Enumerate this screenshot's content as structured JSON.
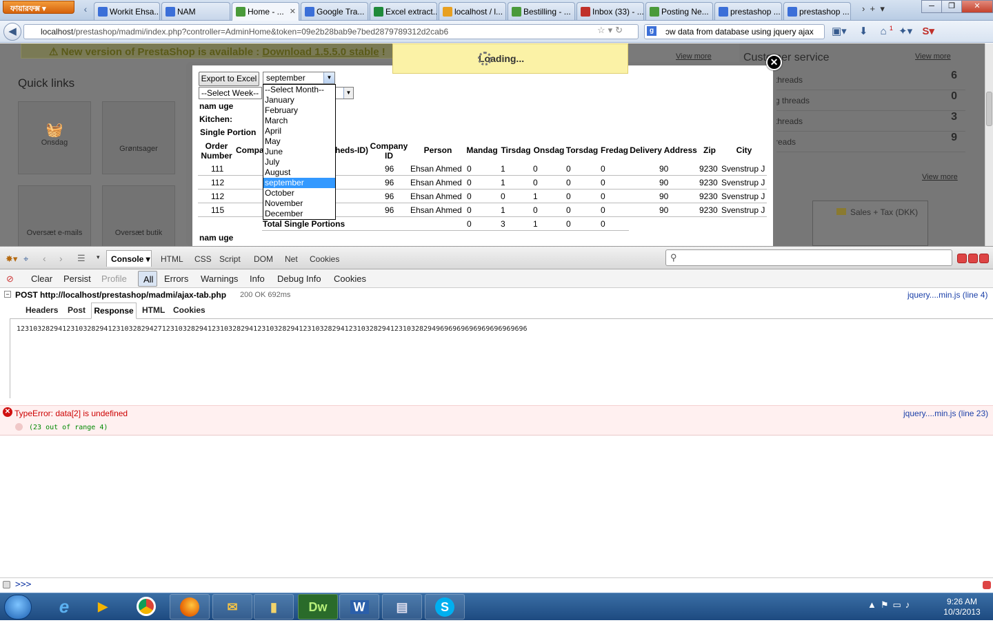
{
  "browser": {
    "firefox_button": "ফায়ারফক্স",
    "tabs": [
      {
        "label": "Workit Ehsa...",
        "color": "#3b6fd8"
      },
      {
        "label": "NAM",
        "color": "#3b6fd8"
      },
      {
        "label": "Home - ...",
        "color": "#4a9a3a"
      },
      {
        "label": "Google Tra...",
        "color": "#3b6fd8"
      },
      {
        "label": "Excel extract...",
        "color": "#1f8a3a"
      },
      {
        "label": "localhost / l...",
        "color": "#e8a020"
      },
      {
        "label": "Bestilling - ...",
        "color": "#4a9a3a"
      },
      {
        "label": "Inbox (33) - ...",
        "color": "#c0302a"
      },
      {
        "label": "Posting Ne...",
        "color": "#4a9a3a"
      },
      {
        "label": "prestashop ...",
        "color": "#3b6fd8"
      },
      {
        "label": "prestashop ...",
        "color": "#3b6fd8"
      }
    ],
    "url_host": "localhost",
    "url_path": "/prestashop/madmi/index.php?controller=AdminHome&token=09e2b28bab9e7bed2879789312d2cab6",
    "search_value": "ɔw data from database using jquery ajax",
    "search_engine_letter": "g",
    "badge_count": "1"
  },
  "page": {
    "notice_text": "New version of PrestaShop is available : ",
    "notice_link": "Download 1.5.5.0 stable",
    "notice_tail": " !",
    "view_more": "View more",
    "quick_links_title": "Quick links",
    "quick_links": [
      "Onsdag",
      "Grøntsager",
      "Oversæt e-mails",
      "Oversæt butik"
    ],
    "customer_service_title": "Customer service",
    "cs_rows": [
      {
        "label": "threads",
        "value": "6"
      },
      {
        "label": "g threads",
        "value": "0"
      },
      {
        "label": "threads",
        "value": "3"
      },
      {
        "label": "reads",
        "value": "9"
      }
    ],
    "chart_legend": "Sales + Tax (DKK)"
  },
  "modal": {
    "loading_text": "Loading...",
    "export_button": "Export to Excel",
    "month_selected": "september",
    "week_placeholder": "--Select Week--",
    "months": [
      "--Select Month--",
      "January",
      "February",
      "March",
      "April",
      "May",
      "June",
      "July",
      "August",
      "september",
      "October",
      "November",
      "December"
    ],
    "labels": {
      "nam_uge": "nam uge",
      "kitchen": "Kitchen:",
      "single_portion": "Single Portion",
      "nam_uge_2": "nam uge"
    },
    "headers": {
      "order_number": "Order Number",
      "company": "Compa",
      "heds_id": "heds-ID)",
      "company_id": "Company ID",
      "person": "Person",
      "mandag": "Mandag",
      "tirsdag": "Tirsdag",
      "onsdag": "Onsdag",
      "torsdag": "Torsdag",
      "fredag": "Fredag",
      "delivery": "Delivery Address",
      "zip": "Zip",
      "city": "City"
    },
    "rows": [
      {
        "order": "111",
        "company_id": "96",
        "person": "Ehsan Ahmed",
        "mandag": "0",
        "tirsdag": "1",
        "onsdag": "0",
        "torsdag": "0",
        "fredag": "0",
        "delivery": "90",
        "zip": "9230",
        "city": "Svenstrup J"
      },
      {
        "order": "112",
        "company_id": "96",
        "person": "Ehsan Ahmed",
        "mandag": "0",
        "tirsdag": "1",
        "onsdag": "0",
        "torsdag": "0",
        "fredag": "0",
        "delivery": "90",
        "zip": "9230",
        "city": "Svenstrup J"
      },
      {
        "order": "112",
        "company_id": "96",
        "person": "Ehsan Ahmed",
        "mandag": "0",
        "tirsdag": "0",
        "onsdag": "1",
        "torsdag": "0",
        "fredag": "0",
        "delivery": "90",
        "zip": "9230",
        "city": "Svenstrup J"
      },
      {
        "order": "115",
        "company_id": "96",
        "person": "Ehsan Ahmed",
        "mandag": "0",
        "tirsdag": "1",
        "onsdag": "0",
        "torsdag": "0",
        "fredag": "0",
        "delivery": "90",
        "zip": "9230",
        "city": "Svenstrup J"
      }
    ],
    "total_label": "Total Single Portions",
    "totals": {
      "mandag": "0",
      "tirsdag": "3",
      "onsdag": "1",
      "torsdag": "0",
      "fredag": "0"
    }
  },
  "firebug": {
    "panel_tabs": [
      "Console",
      "HTML",
      "CSS",
      "Script",
      "DOM",
      "Net",
      "Cookies"
    ],
    "filters": [
      "Clear",
      "Persist",
      "Profile",
      "All",
      "Errors",
      "Warnings",
      "Info",
      "Debug Info",
      "Cookies"
    ],
    "request_line": "POST http://localhost/prestashop/madmi/ajax-tab.php",
    "request_status": "200 OK 692ms",
    "request_source": "jquery....min.js (line 4)",
    "request_tabs": [
      "Headers",
      "Post",
      "Response",
      "HTML",
      "Cookies"
    ],
    "response_body": "123103282941231032829412310328294271231032829412310328294123103282941231032829412310328294123103282949696969696969696969696",
    "error_message": "TypeError: data[2] is undefined",
    "error_detail": "(23 out of range 4)",
    "error_source": "jquery....min.js (line 23)",
    "command_prompt": ">>>"
  },
  "taskbar": {
    "time": "9:26 AM",
    "date": "10/3/2013",
    "apps": [
      "windows-orb",
      "internet-explorer",
      "media-player",
      "chrome",
      "firefox",
      "outlook",
      "explorer",
      "dreamweaver",
      "word",
      "app",
      "skype"
    ]
  }
}
